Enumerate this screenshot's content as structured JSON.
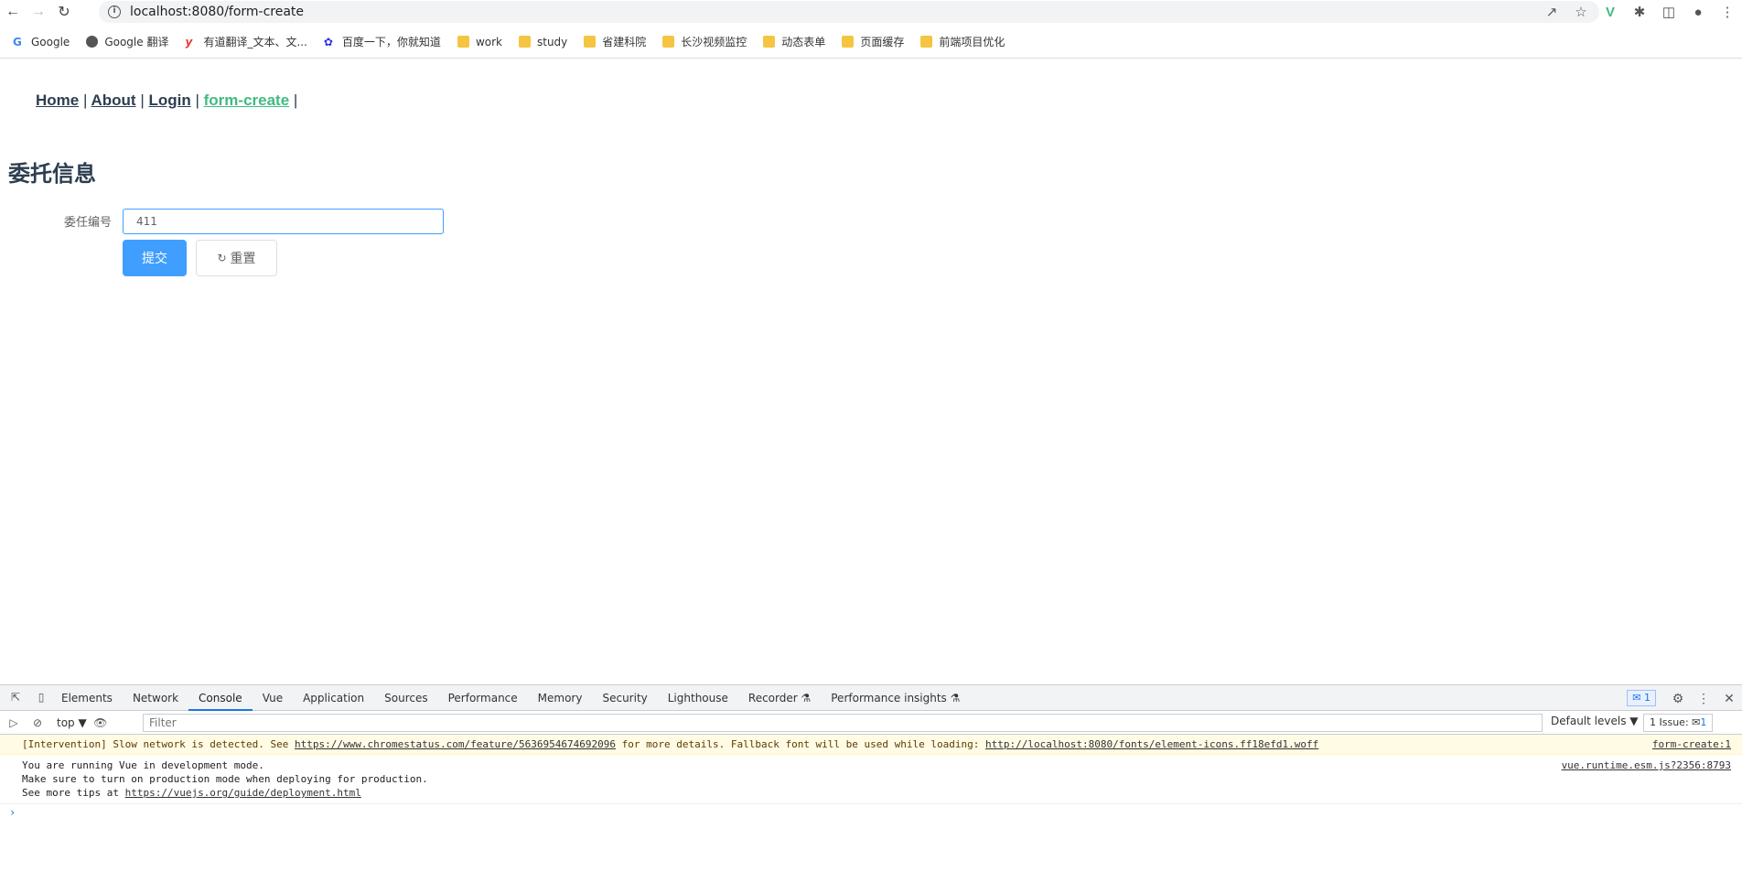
{
  "browser": {
    "url": "localhost:8080/form-create",
    "bookmarks": [
      {
        "label": "Google",
        "icon": "google-icon"
      },
      {
        "label": "Google 翻译",
        "icon": "globe-icon"
      },
      {
        "label": "有道翻译_文本、文...",
        "icon": "youdao-icon"
      },
      {
        "label": "百度一下，你就知道",
        "icon": "baidu-icon"
      },
      {
        "label": "work",
        "icon": "folder-icon"
      },
      {
        "label": "study",
        "icon": "folder-icon"
      },
      {
        "label": "省建科院",
        "icon": "folder-icon"
      },
      {
        "label": "长沙视频监控",
        "icon": "folder-icon"
      },
      {
        "label": "动态表单",
        "icon": "folder-icon"
      },
      {
        "label": "页面缓存",
        "icon": "folder-icon"
      },
      {
        "label": "前端项目优化",
        "icon": "folder-icon"
      }
    ]
  },
  "nav": {
    "home": "Home",
    "about": "About",
    "login": "Login",
    "form_create": "form-create",
    "sep": "|"
  },
  "page": {
    "title": "委托信息"
  },
  "form": {
    "label": "委任编号",
    "value": "411",
    "submit": "提交",
    "reset": "重置"
  },
  "devtools": {
    "tabs": [
      "Elements",
      "Network",
      "Console",
      "Vue",
      "Application",
      "Sources",
      "Performance",
      "Memory",
      "Security",
      "Lighthouse",
      "Recorder ⚗",
      "Performance insights ⚗"
    ],
    "active_tab": "Console",
    "badge": "1",
    "context": "top ▼",
    "filter_placeholder": "Filter",
    "levels": "Default levels ▼",
    "issues_label": "1 Issue:",
    "issues_count": "1",
    "warn": {
      "prefix": "[Intervention] Slow network is detected. See ",
      "link1": "https://www.chromestatus.com/feature/5636954674692096",
      "mid": " for more details. Fallback font will be used while loading: ",
      "link2": "http://localhost:8080/fonts/element-icons.ff18efd1.woff",
      "source": "form-create:1"
    },
    "info": {
      "line1": "You are running Vue in development mode.",
      "line2": "Make sure to turn on production mode when deploying for production.",
      "line3_prefix": "See more tips at ",
      "line3_link": "https://vuejs.org/guide/deployment.html",
      "source": "vue.runtime.esm.js?2356:8793"
    },
    "prompt": "›"
  },
  "colors": {
    "primary": "#409eff",
    "nav_active": "#42b983",
    "text": "#2c3e50"
  }
}
